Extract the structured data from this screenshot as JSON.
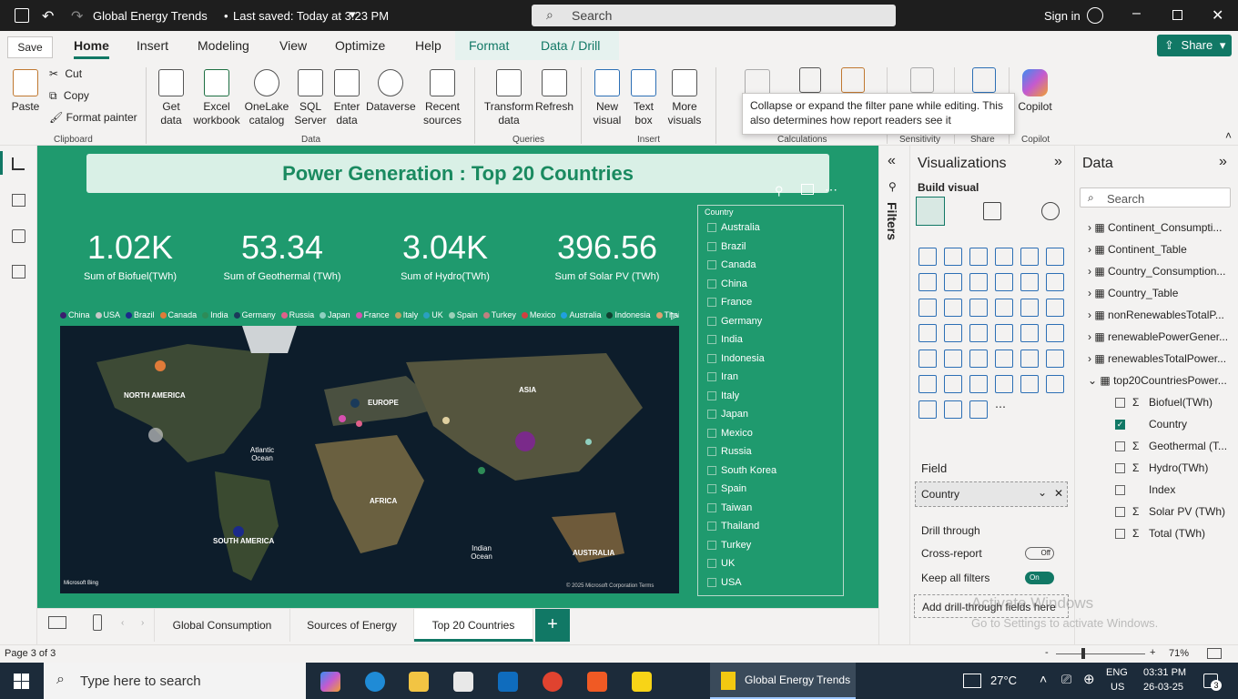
{
  "titlebar": {
    "title": "Global Energy Trends",
    "saved": "Last saved: Today at 3:23 PM",
    "search_placeholder": "Search",
    "signin": "Sign in"
  },
  "save_tooltip": "Save",
  "ribbon_tabs": [
    "Home",
    "Insert",
    "Modeling",
    "View",
    "Optimize",
    "Help",
    "Format",
    "Data / Drill"
  ],
  "share": "Share",
  "clipboard": {
    "paste": "Paste",
    "cut": "Cut",
    "copy": "Copy",
    "format_painter": "Format painter",
    "group": "Clipboard"
  },
  "data_group": {
    "get_data": "Get data",
    "excel": "Excel workbook",
    "onelake": "OneLake catalog",
    "sql": "SQL Server",
    "enter": "Enter data",
    "dataverse": "Dataverse",
    "recent": "Recent sources",
    "group": "Data"
  },
  "queries": {
    "transform": "Transform data",
    "refresh": "Refresh",
    "group": "Queries"
  },
  "insert": {
    "new_visual": "New visual",
    "text_box": "Text box",
    "more_visuals": "More visuals",
    "group": "Insert"
  },
  "calc_group": "Calculations",
  "sensitivity_group": "Sensitivity",
  "share_group": "Share",
  "copilot": {
    "label": "Copilot",
    "group": "Copilot"
  },
  "tooltip": "Collapse or expand the filter pane while editing. This also determines how report readers see it",
  "report": {
    "title": "Power Generation : Top 20 Countries",
    "kpis": [
      {
        "value": "1.02K",
        "label": "Sum of Biofuel(TWh)"
      },
      {
        "value": "53.34",
        "label": "Sum of Geothermal (TWh)"
      },
      {
        "value": "3.04K",
        "label": "Sum of Hydro(TWh)"
      },
      {
        "value": "396.56",
        "label": "Sum of Solar PV (TWh)"
      }
    ],
    "legend": [
      {
        "name": "China",
        "color": "#3b1e6e"
      },
      {
        "name": "USA",
        "color": "#c8c8c8"
      },
      {
        "name": "Brazil",
        "color": "#1b2a8a"
      },
      {
        "name": "Canada",
        "color": "#e07b39"
      },
      {
        "name": "India",
        "color": "#2e8b57"
      },
      {
        "name": "Germany",
        "color": "#1a3a5a"
      },
      {
        "name": "Russia",
        "color": "#e0608a"
      },
      {
        "name": "Japan",
        "color": "#8fd0c0"
      },
      {
        "name": "France",
        "color": "#d74fb0"
      },
      {
        "name": "Italy",
        "color": "#c0a060"
      },
      {
        "name": "UK",
        "color": "#2aa0c0"
      },
      {
        "name": "Spain",
        "color": "#9ad0b8"
      },
      {
        "name": "Turkey",
        "color": "#c08080"
      },
      {
        "name": "Mexico",
        "color": "#d04040"
      },
      {
        "name": "Australia",
        "color": "#20a0e0"
      },
      {
        "name": "Indonesia",
        "color": "#104030"
      },
      {
        "name": "Thailand",
        "color": "#e0a070"
      }
    ],
    "map_labels": {
      "na": "NORTH AMERICA",
      "eu": "EUROPE",
      "asia": "ASIA",
      "atl": "Atlantic Ocean",
      "af": "AFRICA",
      "sa": "SOUTH AMERICA",
      "ind": "Indian Ocean",
      "au": "AUSTRALIA",
      "bing": "Microsoft Bing",
      "copy": "© 2025 Microsoft Corporation  Terms"
    },
    "slicer_title": "Country",
    "slicer_items": [
      "Australia",
      "Brazil",
      "Canada",
      "China",
      "France",
      "Germany",
      "India",
      "Indonesia",
      "Iran",
      "Italy",
      "Japan",
      "Mexico",
      "Russia",
      "South Korea",
      "Spain",
      "Taiwan",
      "Thailand",
      "Turkey",
      "UK",
      "USA"
    ]
  },
  "pages": [
    "Global Consumption",
    "Sources of Energy",
    "Top 20 Countries"
  ],
  "status": {
    "page": "Page 3 of 3",
    "zoom": "71%"
  },
  "filters_label": "Filters",
  "viz": {
    "title": "Visualizations",
    "build": "Build visual",
    "field": "Field",
    "field_value": "Country",
    "drill": "Drill through",
    "cross": "Cross-report",
    "cross_state": "Off",
    "keep": "Keep all filters",
    "keep_state": "On",
    "add": "Add drill-through fields here"
  },
  "data": {
    "title": "Data",
    "search": "Search",
    "tables": [
      "Continent_Consumpti...",
      "Continent_Table",
      "Country_Consumption...",
      "Country_Table",
      "nonRenewablesTotalP...",
      "renewablePowerGener...",
      "renewablesTotalPower...",
      "top20CountriesPower..."
    ],
    "fields": [
      "Biofuel(TWh)",
      "Country",
      "Geothermal (T...",
      "Hydro(TWh)",
      "Index",
      "Solar PV (TWh)",
      "Total (TWh)"
    ]
  },
  "watermark": {
    "line1": "Activate Windows",
    "line2": "Go to Settings to activate Windows."
  },
  "taskbar": {
    "search": "Type here to search",
    "app": "Global Energy Trends",
    "temp": "27°C",
    "lang": "ENG",
    "region": "US",
    "time": "03:31 PM",
    "date": "26-03-25",
    "notif": "3"
  }
}
